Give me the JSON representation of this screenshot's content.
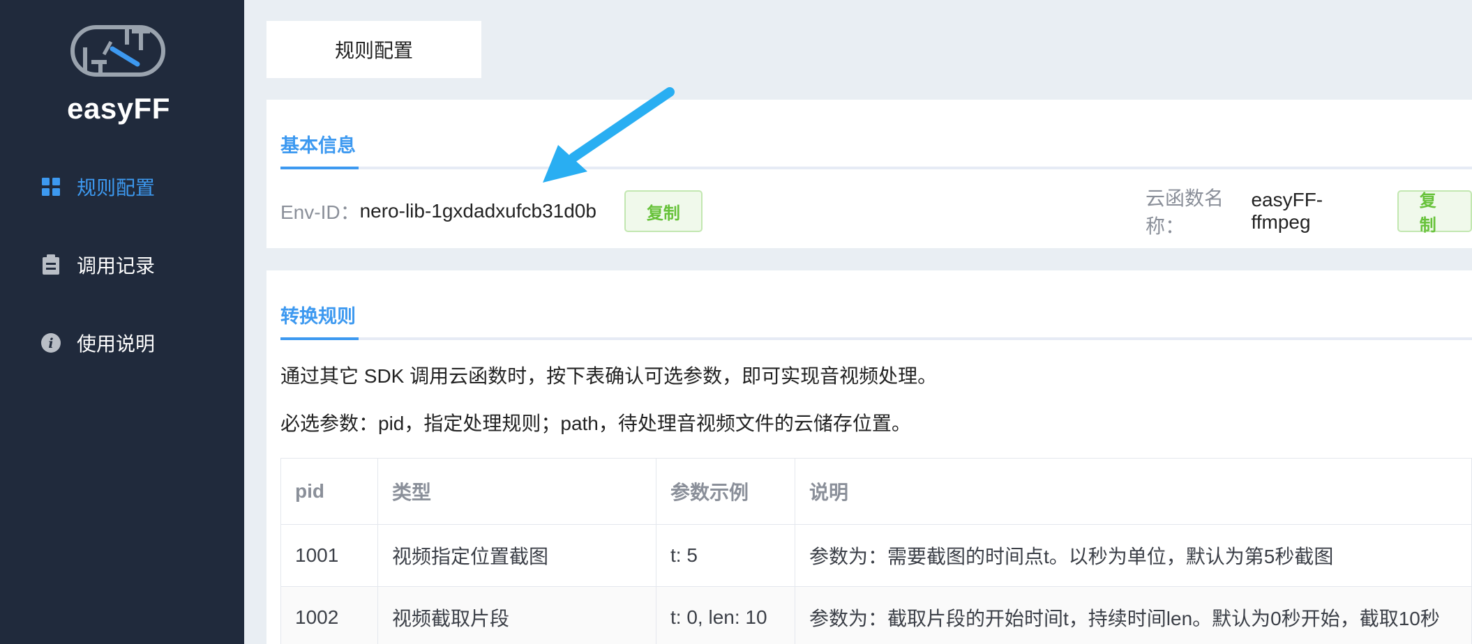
{
  "app": {
    "brand": "easyFF"
  },
  "sidebar": {
    "items": [
      {
        "label": "规则配置",
        "icon": "grid-icon",
        "active": true
      },
      {
        "label": "调用记录",
        "icon": "clipboard-icon",
        "active": false
      },
      {
        "label": "使用说明",
        "icon": "info-icon",
        "active": false
      }
    ]
  },
  "tabs": [
    {
      "label": "规则配置"
    }
  ],
  "basic": {
    "title": "基本信息",
    "env_label": "Env-ID：",
    "env_value": "nero-lib-1gxdadxufcb31d0b",
    "copy_label": "复制",
    "func_label": "云函数名称：",
    "func_value": "easyFF-ffmpeg",
    "copy_label2": "复制"
  },
  "rules": {
    "title": "转换规则",
    "para1": "通过其它 SDK 调用云函数时，按下表确认可选参数，即可实现音视频处理。",
    "para2": "必选参数：pid，指定处理规则；path，待处理音视频文件的云储存位置。",
    "table": {
      "headers": [
        "pid",
        "类型",
        "参数示例",
        "说明"
      ],
      "rows": [
        [
          "1001",
          "视频指定位置截图",
          "t: 5",
          "参数为：需要截图的时间点t。以秒为单位，默认为第5秒截图"
        ],
        [
          "1002",
          "视频截取片段",
          "t: 0, len: 10",
          "参数为：截取片段的开始时间t，持续时间len。默认为0秒开始，截取10秒"
        ]
      ]
    }
  },
  "colors": {
    "sidebar_bg": "#202a3c",
    "accent": "#3d99f0",
    "copy_green": "#67c23a",
    "annotation_arrow": "#29aef2"
  }
}
